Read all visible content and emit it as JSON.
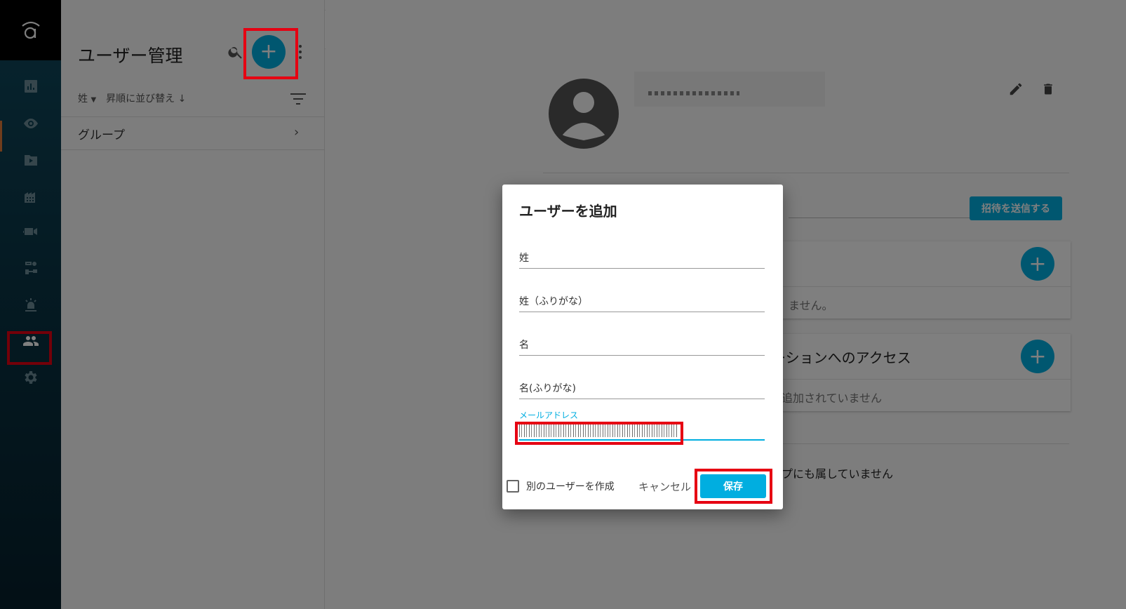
{
  "rail": {
    "items": [
      {
        "icon": "dashboard-icon"
      },
      {
        "icon": "eye-icon"
      },
      {
        "icon": "video-folder-icon"
      },
      {
        "icon": "building-icon"
      },
      {
        "icon": "camera-icon"
      },
      {
        "icon": "workflow-icon"
      },
      {
        "icon": "alarm-icon"
      },
      {
        "icon": "users-icon",
        "active": true
      },
      {
        "icon": "gear-icon"
      }
    ]
  },
  "list": {
    "title": "ユーザー管理",
    "sort_field": "姓",
    "sort_order": "昇順に並び替え",
    "group_label": "グループ"
  },
  "detail": {
    "invite_button": "招待を送信する",
    "card1_body": "ません。",
    "card2_header": "ーションへのアクセス",
    "card2_body": "追加されていません",
    "groups_text": "プにも属していません"
  },
  "dialog": {
    "title": "ユーザーを追加",
    "fields": {
      "last_name": "姓",
      "last_name_kana": "姓（ふりがな）",
      "first_name": "名",
      "first_name_kana": "名(ふりがな)",
      "email": "メールアドレス"
    },
    "create_another": "別のユーザーを作成",
    "cancel": "キャンセル",
    "save": "保存"
  },
  "colors": {
    "accent": "#00aee0",
    "highlight": "#e60012",
    "rail_top": "#0f4a5f",
    "rail_bottom": "#06202c"
  }
}
